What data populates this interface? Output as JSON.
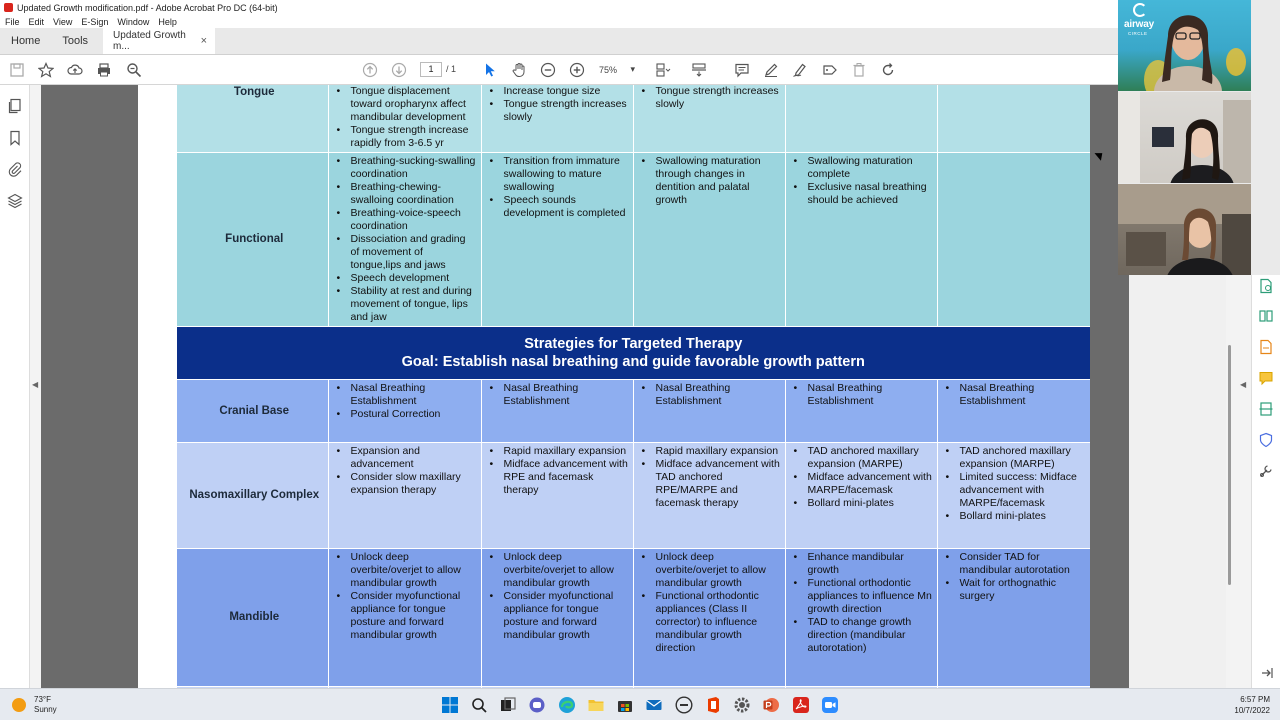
{
  "window": {
    "title": "Updated Growth modification.pdf - Adobe Acrobat Pro DC (64-bit)"
  },
  "menu": [
    "File",
    "Edit",
    "View",
    "E-Sign",
    "Window",
    "Help"
  ],
  "tabs": {
    "home": "Home",
    "tools": "Tools",
    "document": "Updated Growth m...",
    "close": "×"
  },
  "toolbar": {
    "page_current": "1",
    "page_total": "/ 1",
    "zoom": "75%",
    "zoom_arrow": "▾"
  },
  "table": {
    "top_rows": [
      {
        "label": "Tongue",
        "style": "cyan",
        "cells": [
          [
            "Tongue displacement toward oropharynx affect mandibular development",
            "Tongue strength increase rapidly from 3-6.5 yr"
          ],
          [
            "Increase tongue size",
            "Tongue strength increases slowly"
          ],
          [
            "Tongue strength increases slowly"
          ],
          [],
          []
        ]
      },
      {
        "label": "Functional",
        "style": "cyan2",
        "cells": [
          [
            "Breathing-sucking-swalling coordination",
            "Breathing-chewing-swalloing coordination",
            "Breathing-voice-speech coordination",
            "Dissociation and grading of movement of tongue,lips and jaws",
            "Speech development",
            "Stability at rest and during movement of tongue, lips and jaw"
          ],
          [
            "Transition from immature swallowing to mature swallowing",
            "Speech sounds development is completed"
          ],
          [
            "Swallowing maturation through changes in dentition and palatal growth"
          ],
          [
            "Swallowing maturation complete",
            "Exclusive nasal breathing should be achieved"
          ],
          []
        ]
      }
    ],
    "banner": {
      "line1": "Strategies for Targeted Therapy",
      "line2": "Goal: Establish nasal breathing and guide favorable growth pattern"
    },
    "bottom_rows": [
      {
        "label": "Cranial Base",
        "style": "blue1",
        "cells": [
          [
            "Nasal Breathing Establishment",
            "Postural Correction"
          ],
          [
            "Nasal Breathing Establishment"
          ],
          [
            "Nasal Breathing Establishment"
          ],
          [
            "Nasal Breathing Establishment"
          ],
          [
            "Nasal Breathing Establishment"
          ]
        ]
      },
      {
        "label": "Nasomaxillary Complex",
        "style": "blue2",
        "cells": [
          [
            "Expansion and advancement",
            "Consider slow maxillary expansion therapy"
          ],
          [
            "Rapid maxillary expansion",
            "Midface advancement with RPE and facemask therapy"
          ],
          [
            "Rapid maxillary expansion",
            "Midface advancement with TAD anchored RPE/MARPE and facemask therapy"
          ],
          [
            "TAD anchored maxillary expansion (MARPE)",
            "Midface advancement with MARPE/facemask",
            "Bollard mini-plates"
          ],
          [
            "TAD anchored maxillary expansion (MARPE)",
            "Limited success: Midface advancement with MARPE/facemask",
            "Bollard mini-plates"
          ]
        ]
      },
      {
        "label": "Mandible",
        "style": "blue3",
        "cells": [
          [
            "Unlock deep overbite/overjet to allow mandibular growth",
            "Consider myofunctional appliance for tongue posture and forward mandibular growth"
          ],
          [
            "Unlock deep overbite/overjet to allow mandibular growth",
            "Consider myofunctional appliance for tongue posture and forward mandibular growth"
          ],
          [
            "Unlock deep overbite/overjet to allow mandibular growth",
            "Functional orthodontic appliances (Class II corrector) to influence mandibular growth direction"
          ],
          [
            "Enhance mandibular growth",
            "Functional orthodontic appliances to influence Mn growth direction",
            "TAD to change growth direction (mandibular autorotation)"
          ],
          [
            "Consider TAD for mandibular autorotation",
            "Wait for orthognathic surgery"
          ]
        ]
      },
      {
        "label": "",
        "style": "blue4",
        "cells": [
          [],
          [],
          [],
          [],
          []
        ]
      }
    ]
  },
  "video": {
    "logo_line1": "airway",
    "logo_line2": "CIRCLE"
  },
  "taskbar": {
    "temperature": "73°F",
    "condition": "Sunny",
    "time": "6:57 PM",
    "date": "10/7/2022"
  },
  "colors": {
    "acrobat_red": "#d9251c",
    "banner_navy": "#0b2f8a",
    "row_cyan": "#b3e0e7",
    "row_blue": "#8eaef0"
  }
}
